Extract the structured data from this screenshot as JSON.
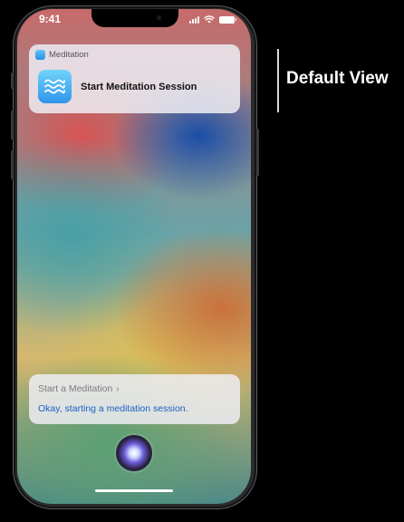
{
  "status_bar": {
    "time": "9:41"
  },
  "notification": {
    "app_name": "Meditation",
    "action_label": "Start Meditation Session",
    "app_icon": "waves-icon"
  },
  "siri_card": {
    "suggestion": "Start a Meditation",
    "suggestion_chevron": "›",
    "response": "Okay, starting a meditation session."
  },
  "caption": {
    "label": "Default View"
  },
  "colors": {
    "link_blue": "#1c5fc0",
    "app_icon_blue": "#3aa8f0",
    "background": "#000000"
  }
}
